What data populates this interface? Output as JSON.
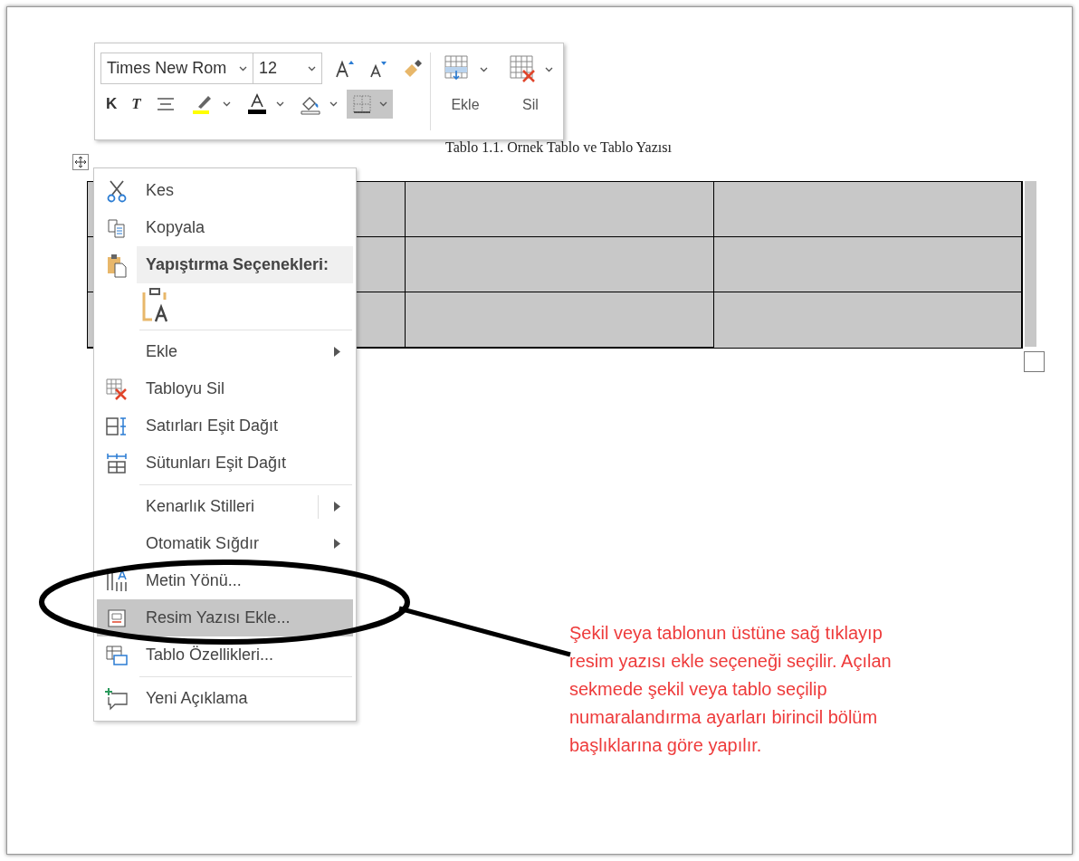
{
  "toolbar": {
    "font": {
      "value": "Times New Rom"
    },
    "size": {
      "value": "12"
    },
    "format_buttons": [
      {
        "kind": "grow",
        "selected": false
      },
      {
        "kind": "shrink",
        "selected": false
      },
      {
        "kind": "painter",
        "selected": false
      },
      {
        "kind": "bold",
        "label": "K",
        "selected": false
      },
      {
        "kind": "italic",
        "label": "T",
        "selected": false
      },
      {
        "kind": "align",
        "selected": false
      },
      {
        "kind": "highlight",
        "selected": false
      },
      {
        "kind": "fontcolor",
        "selected": false
      },
      {
        "kind": "shading",
        "selected": false
      },
      {
        "kind": "borders",
        "selected": true
      }
    ],
    "table_buttons": [
      {
        "kind": "insert",
        "label": "Ekle"
      },
      {
        "kind": "delete",
        "label": "Sil"
      }
    ]
  },
  "caption": "Tablo 1.1. Ornek Tablo ve Tablo Yazısı",
  "context_menu": [
    {
      "kind": "cut",
      "label": "Kes",
      "submenu": false,
      "selected": false
    },
    {
      "kind": "copy",
      "label": "Kopyala",
      "submenu": false,
      "selected": false
    },
    {
      "kind": "header",
      "label": "Yapıştırma Seçenekleri:"
    },
    {
      "kind": "paste"
    },
    {
      "kind": "separator"
    },
    {
      "kind": "plain",
      "label": "Ekle",
      "submenu": true,
      "selected": false
    },
    {
      "kind": "deletetable",
      "label": "Tabloyu Sil",
      "submenu": false,
      "selected": false
    },
    {
      "kind": "rows",
      "label": "Satırları Eşit Dağıt",
      "submenu": false,
      "selected": false
    },
    {
      "kind": "cols",
      "label": "Sütunları Eşit Dağıt",
      "submenu": false,
      "selected": false
    },
    {
      "kind": "separator"
    },
    {
      "kind": "plain",
      "label": "Kenarlık Stilleri",
      "submenu": true,
      "split": true,
      "selected": false
    },
    {
      "kind": "plain",
      "label": "Otomatik Sığdır",
      "submenu": true,
      "selected": false
    },
    {
      "kind": "textdir",
      "label": "Metin Yönü...",
      "submenu": false,
      "selected": false
    },
    {
      "kind": "caption",
      "label": "Resim Yazısı Ekle...",
      "submenu": false,
      "selected": true
    },
    {
      "kind": "props",
      "label": "Tablo Özellikleri...",
      "submenu": false,
      "selected": false
    },
    {
      "kind": "separator"
    },
    {
      "kind": "comment",
      "label": "Yeni Açıklama",
      "submenu": false,
      "selected": false
    }
  ],
  "note": "Şekil veya tablonun üstüne sağ tıklayıp resim yazısı ekle seçeneği seçilir. Açılan sekmede şekil veya tablo seçilip numaralandırma ayarları birincil bölüm başlıklarına göre yapılır."
}
